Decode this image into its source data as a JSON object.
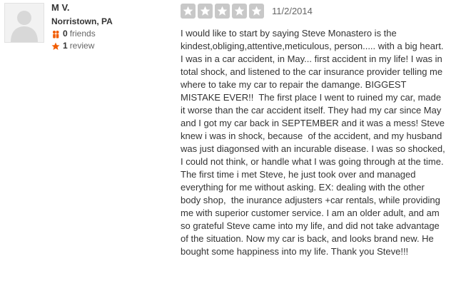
{
  "user": {
    "name": "M V.",
    "location": "Norristown, PA",
    "friends_count": "0",
    "friends_label": "friends",
    "reviews_count": "1",
    "reviews_label": "review"
  },
  "review": {
    "rating": 5,
    "rating_max": 5,
    "date": "11/2/2014",
    "text": "I would like to start by saying Steve Monastero is the kindest,obliging,attentive,meticulous, person..... with a big heart. I was in a car accident, in May... first accident in my life! I was in total shock, and listened to the car insurance provider telling me where to take my car to repair the damange. BIGGEST MISTAKE EVER!!  The first place I went to ruined my car, made it worse than the car accident itself. They had my car since May and I got my car back in SEPTEMBER and it was a mess! Steve knew i was in shock, because  of the accident, and my husband was just diagonsed with an incurable disease. I was so shocked, I could not think, or handle what I was going through at the time. The first time i met Steve, he just took over and managed everything for me without asking. EX: dealing with the other body shop,  the inurance adjusters +car rentals, while providing me with superior customer service. I am an older adult, and am so grateful Steve came into my life, and did not take advantage of the situation. Now my car is back, and looks brand new. He bought some happiness into my life. Thank you Steve!!!"
  },
  "colors": {
    "star_fill": "#c8c8c8",
    "friends_icon": "#f15c00",
    "review_icon": "#f15c00"
  },
  "icons": {
    "avatar": "default-user-silhouette",
    "friends": "friends-icon",
    "reviews": "star-icon",
    "rating_star": "star-icon"
  }
}
